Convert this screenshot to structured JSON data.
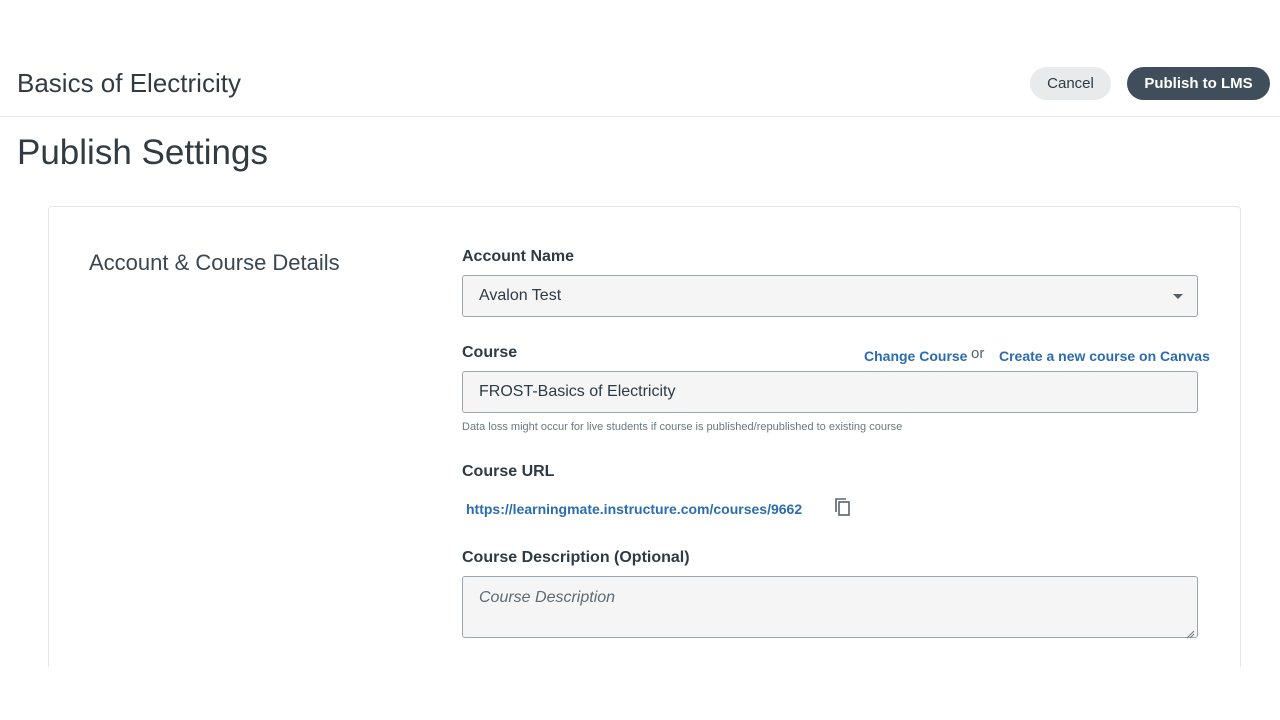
{
  "header": {
    "course_title": "Basics of Electricity",
    "cancel_label": "Cancel",
    "publish_label": "Publish to LMS"
  },
  "page": {
    "heading": "Publish Settings"
  },
  "section": {
    "title": "Account & Course Details"
  },
  "account": {
    "label": "Account Name",
    "selected_value": "Avalon Test"
  },
  "course": {
    "label": "Course",
    "change_link": "Change Course",
    "or_text": "or",
    "create_link": "Create a new course on Canvas",
    "value": "FROST-Basics of Electricity",
    "hint": "Data loss might occur for live students if course is published/republished to existing course"
  },
  "course_url": {
    "label": "Course URL",
    "url": "https://learningmate.instructure.com/courses/9662"
  },
  "description": {
    "label": "Course Description (Optional)",
    "placeholder": "Course Description",
    "value": ""
  },
  "icons": {
    "copy": "copy-icon",
    "dropdown": "chevron-down-icon",
    "resize": "resize-grip-icon"
  },
  "colors": {
    "primary_button": "#3f4e5a",
    "secondary_button": "#e8eaec",
    "link": "#2b6cb0"
  }
}
